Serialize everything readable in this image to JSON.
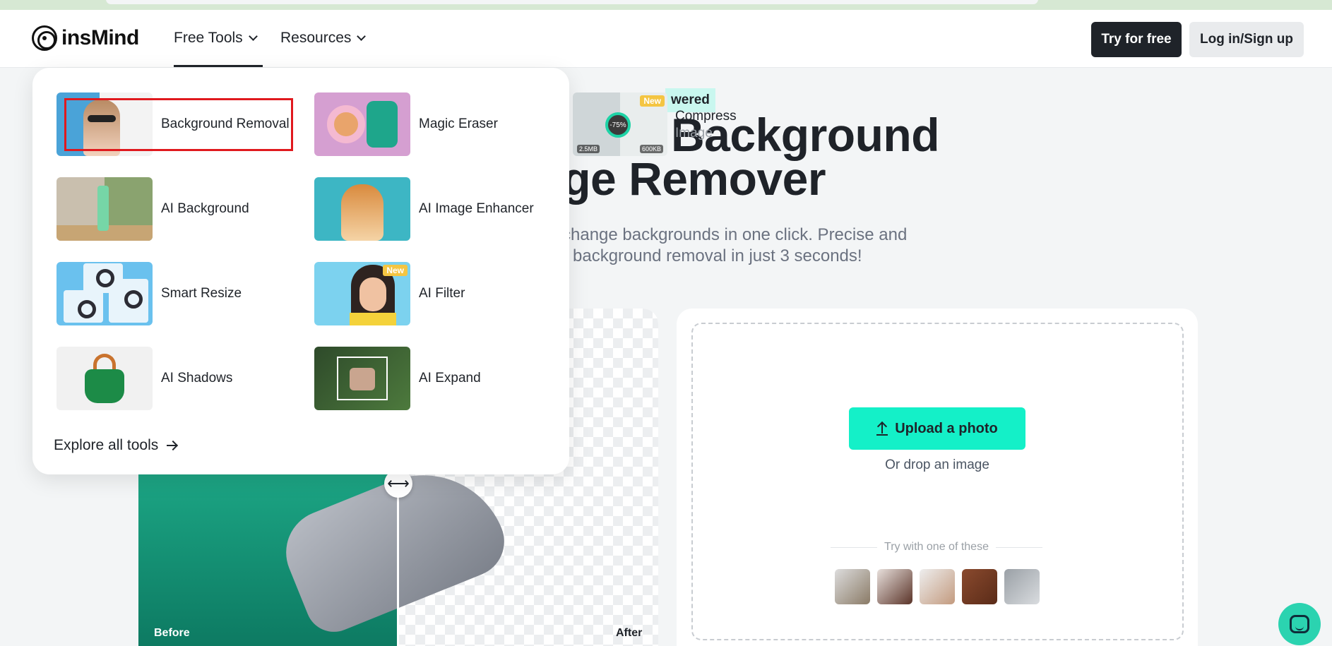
{
  "header": {
    "logo_text": "insMind",
    "nav": [
      {
        "label": "Free Tools"
      },
      {
        "label": "Resources"
      }
    ],
    "try_button": "Try for free",
    "login_button": "Log in/Sign up"
  },
  "hero": {
    "badge": "wered",
    "title_line1": "Background",
    "title_line2": "age Remover",
    "subtitle_line1": "change backgrounds in one click. Precise and",
    "subtitle_line2": "background removal in just 3 seconds!"
  },
  "compare": {
    "before_label": "Before",
    "after_label": "After",
    "handle_glyph": "⟷"
  },
  "upload": {
    "button_label": "Upload a photo",
    "drop_text": "Or drop an image",
    "try_text": "Try with one of these"
  },
  "dropdown": {
    "tools": [
      {
        "label": "Background Removal"
      },
      {
        "label": "Magic Eraser"
      },
      {
        "label": "AI Background"
      },
      {
        "label": "AI Image Enhancer"
      },
      {
        "label": "Smart Resize"
      },
      {
        "label": "AI Filter",
        "badge": "New"
      },
      {
        "label": "AI Shadows"
      },
      {
        "label": "AI Expand"
      }
    ],
    "compress": {
      "label_line1": "Compress",
      "label_line2": "Image",
      "badge": "New",
      "percent": "-75%",
      "size_before": "2.5MB",
      "size_after": "600KB"
    },
    "explore_label": "Explore all tools"
  },
  "icons": {
    "chevron": "chevron-down-icon",
    "arrow": "arrow-right-icon",
    "upload": "upload-icon",
    "chat": "chat-icon"
  },
  "colors": {
    "accent": "#14f0c8",
    "dark_button": "#1f2329",
    "highlight": "#e0191e"
  }
}
